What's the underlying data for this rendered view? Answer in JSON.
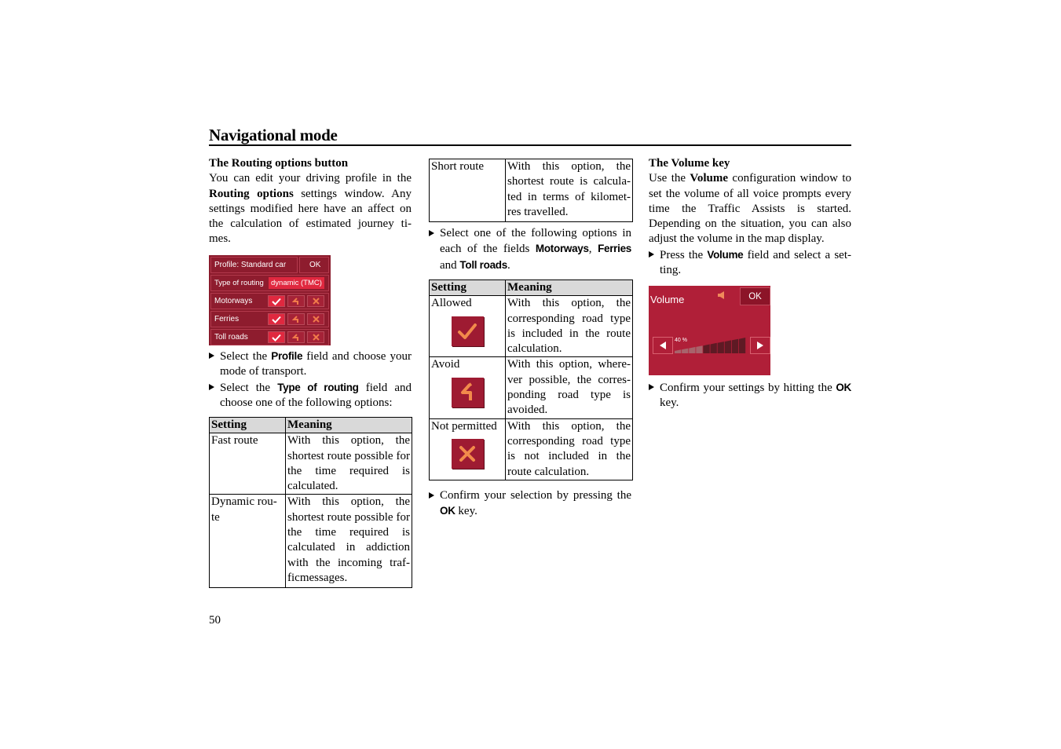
{
  "page": {
    "title": "Navigational mode",
    "page_number": "50"
  },
  "col1": {
    "heading": "The Routing options button",
    "intro_1": "You can edit your driving profile in the",
    "intro_bold": "Routing options",
    "intro_2": " settings window. Any",
    "intro_3": " settings modified here have an affect on the calculation of estimated journey ti-mes.",
    "routing_panel": {
      "profile_label": "Profile: Standard car",
      "ok_label": "OK",
      "routing_type_label": "Type of routing",
      "routing_type_value": "dynamic (TMC)",
      "rows": [
        {
          "label": "Motorways",
          "selected": "allowed"
        },
        {
          "label": "Ferries",
          "selected": "allowed"
        },
        {
          "label": "Toll roads",
          "selected": "allowed"
        }
      ],
      "colors": {
        "panel": "#8a1a2b",
        "selected": "#e0283f",
        "icon": "#f07a4a"
      }
    },
    "bullet1_a": "Select the ",
    "bullet1_b": "Profile",
    "bullet1_c": " field and choose your mode of transport.",
    "bullet2_a": "Select the ",
    "bullet2_b": "Type of routing",
    "bullet2_c": " field and choose one of the following options:",
    "table": {
      "headers": [
        "Setting",
        "Meaning"
      ],
      "rows": [
        {
          "setting": "Fast route",
          "meaning": "With this option, the shortest route possible for the time required is calculated."
        },
        {
          "setting": "Dynamic rou-te",
          "meaning": "With this option, the shortest route possible for the time required is calculated in addiction with the incoming traf-ficmessages."
        }
      ]
    }
  },
  "col2": {
    "table_cont": {
      "rows": [
        {
          "setting": "Short route",
          "meaning": "With this option, the shortest route is calcula-ted in terms of kilomet-res travelled."
        }
      ]
    },
    "bullet1_a": "Select one of the following options in each of the fields ",
    "bullet1_b": "Motorways",
    "bullet1_c": ", ",
    "bullet1_d": "Ferries",
    "bullet1_e": " and ",
    "bullet1_f": "Toll roads",
    "bullet1_g": ".",
    "table": {
      "headers": [
        "Setting",
        "Meaning"
      ],
      "rows": [
        {
          "setting": "Allowed",
          "icon": "checkmark-icon",
          "meaning": "With this option, the corresponding road type is included in the route calculation."
        },
        {
          "setting": "Avoid",
          "icon": "avoid-icon",
          "meaning": "With this option, where-ver possible, the corres-ponding road type is avoided."
        },
        {
          "setting": "Not permitted",
          "icon": "cross-icon",
          "meaning": "With this option, the corresponding road type is not included in the route calculation."
        }
      ]
    },
    "bullet2_a": "Confirm your selection by pressing the ",
    "bullet2_b": "OK",
    "bullet2_c": " key."
  },
  "col3": {
    "heading": "The Volume key",
    "p1_a": "Use the ",
    "p1_b": "Volume",
    "p1_c": " configuration window to set the volume of all voice prompts every time the Traffic Assists is started. Depending on the situation, you can also adjust the volume in the map display.",
    "bullet1_a": "Press the ",
    "bullet1_b": "Volume",
    "bullet1_c": " field and select a set-ting.",
    "volume_panel": {
      "title": "Volume",
      "ok_label": "OK",
      "level_text": "40 %",
      "level_percent": 40,
      "segments": 10,
      "colors": {
        "panel": "#b01f38",
        "bar_filled": "#a8636b",
        "bar_empty": "#5e1a24"
      }
    },
    "bullet2_a": "Confirm your settings by hitting the ",
    "bullet2_b": "OK",
    "bullet2_c": " key."
  }
}
